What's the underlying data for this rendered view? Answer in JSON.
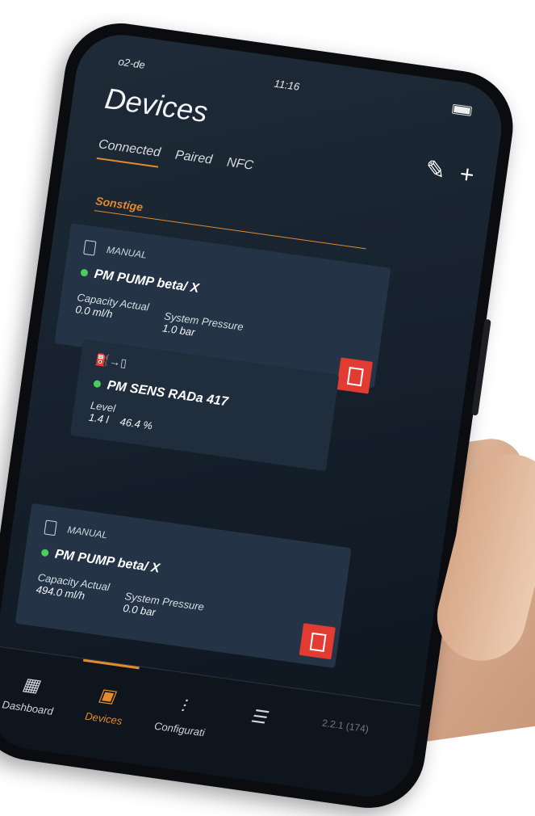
{
  "status": {
    "carrier": "o2-de",
    "time": "11:16"
  },
  "header": {
    "title": "Devices",
    "edit_icon": "pencil-icon",
    "add_icon": "plus-icon"
  },
  "tabs": [
    {
      "label": "Connected",
      "active": true
    },
    {
      "label": "Paired",
      "active": false
    },
    {
      "label": "NFC",
      "active": false
    }
  ],
  "section_label": "Sonstige",
  "devices": [
    {
      "mode": "MANUAL",
      "name": "PM PUMP beta/ X",
      "capacity_label": "Capacity Actual",
      "capacity_value": "0.0 ml/h",
      "pressure_label": "System Pressure",
      "pressure_value": "1.0 bar"
    },
    {
      "mode": "MANUAL",
      "name": "PM PUMP beta/ X",
      "capacity_label": "Capacity Actual",
      "capacity_value": "494.0 ml/h",
      "pressure_label": "System Pressure",
      "pressure_value": "0.0 bar"
    }
  ],
  "sensor": {
    "name": "PM SENS RADa 417",
    "level_label": "Level",
    "level_value": "1.4 l",
    "level_percent": "46.4 %"
  },
  "nav": [
    {
      "label": "Dashboard",
      "icon": "dashboard-icon",
      "active": false
    },
    {
      "label": "Devices",
      "icon": "device-icon",
      "active": true
    },
    {
      "label": "Configurati",
      "icon": "sliders-icon",
      "active": false
    },
    {
      "label": "",
      "icon": "menu-icon",
      "active": false
    }
  ],
  "version": "2.2.1 (174)",
  "colors": {
    "accent": "#e38b2f",
    "status_ok": "#4ccc5a",
    "stop": "#e23b32",
    "bg": "#1a2633"
  }
}
